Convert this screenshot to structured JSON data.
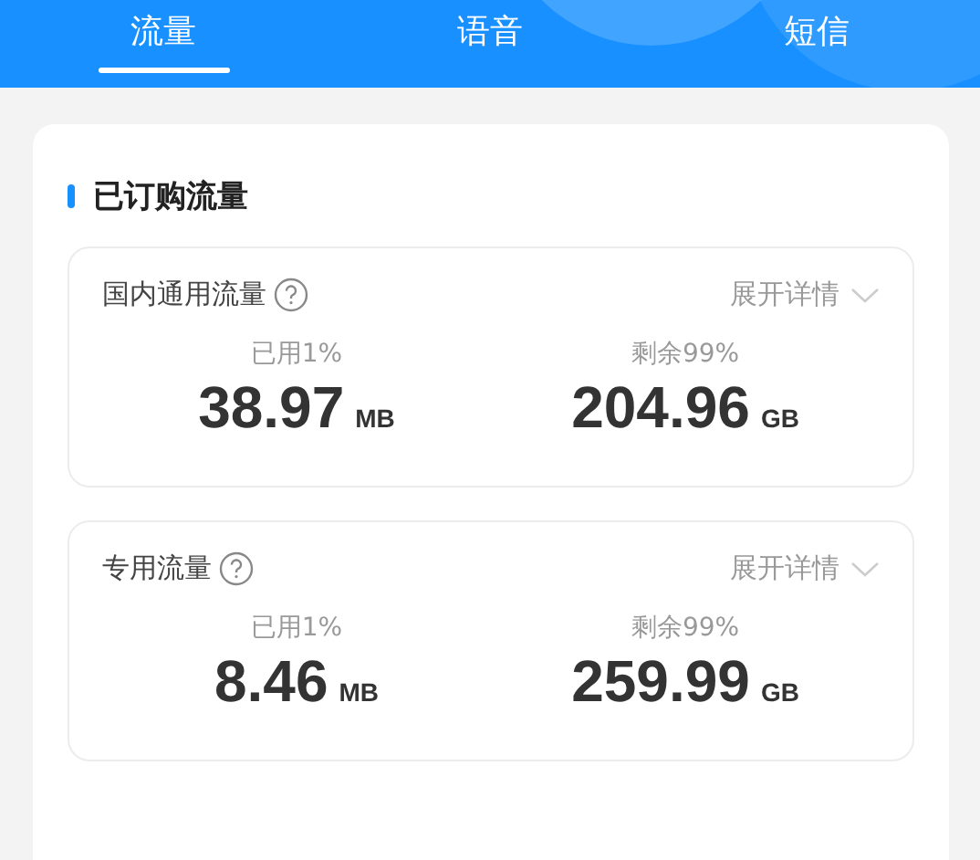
{
  "tabs": [
    {
      "label": "流量",
      "selected": true
    },
    {
      "label": "语音",
      "selected": false
    },
    {
      "label": "短信",
      "selected": false
    }
  ],
  "section": {
    "title": "已订购流量",
    "packages": [
      {
        "name": "国内通用流量",
        "expand": "展开详情",
        "used": {
          "label": "已用1%",
          "value": "38.97",
          "unit": "MB"
        },
        "remaining": {
          "label": "剩余99%",
          "value": "204.96",
          "unit": "GB"
        }
      },
      {
        "name": "专用流量",
        "expand": "展开详情",
        "used": {
          "label": "已用1%",
          "value": "8.46",
          "unit": "MB"
        },
        "remaining": {
          "label": "剩余99%",
          "value": "259.99",
          "unit": "GB"
        }
      }
    ]
  }
}
